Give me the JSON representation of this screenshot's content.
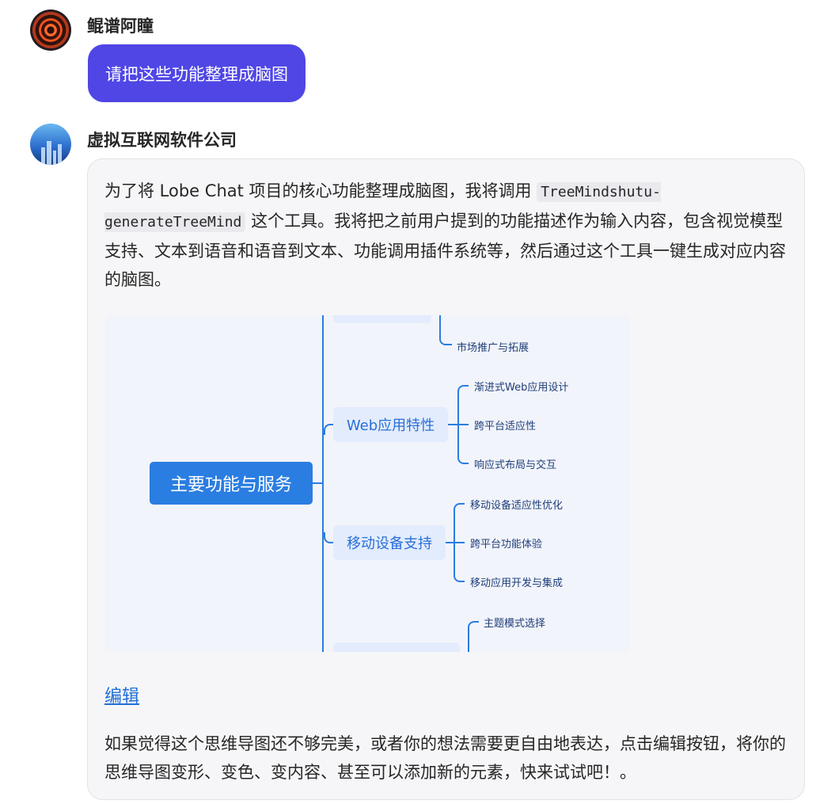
{
  "user_message": {
    "author": "鲲谱阿瞳",
    "text": "请把这些功能整理成脑图"
  },
  "ai_message": {
    "author": "虚拟互联网软件公司",
    "intro_1": "为了将 Lobe Chat 项目的核心功能整理成脑图，我将调用 ",
    "intro_code": "TreeMindshutu-generateTreeMind",
    "intro_2": " 这个工具。我将把之前用户提到的功能描述作为输入内容，包含视觉模型支持、文本到语音和语音到文本、功能调用插件系统等，然后通过这个工具一键生成对应内容的脑图。",
    "edit_link": "编辑",
    "outro": "如果觉得这个思维导图还不够完美，或者你的想法需要更自由地表达，点击编辑按钮，将你的思维导图变形、变色、变内容、甚至可以添加新的元素，快来试试吧！。"
  },
  "mindmap": {
    "root": "主要功能与服务",
    "top_leaf": "市场推广与拓展",
    "branches": [
      {
        "label": "Web应用特性",
        "leaves": [
          "渐进式Web应用设计",
          "跨平台适应性",
          "响应式布局与交互"
        ]
      },
      {
        "label": "移动设备支持",
        "leaves": [
          "移动设备适应性优化",
          "跨平台功能体验",
          "移动应用开发与集成"
        ]
      }
    ],
    "bottom_leaf": "主题模式选择"
  },
  "colors": {
    "user_bubble": "#4f46e5",
    "mindmap_accent": "#2a7de1",
    "link": "#1f6fd6"
  }
}
